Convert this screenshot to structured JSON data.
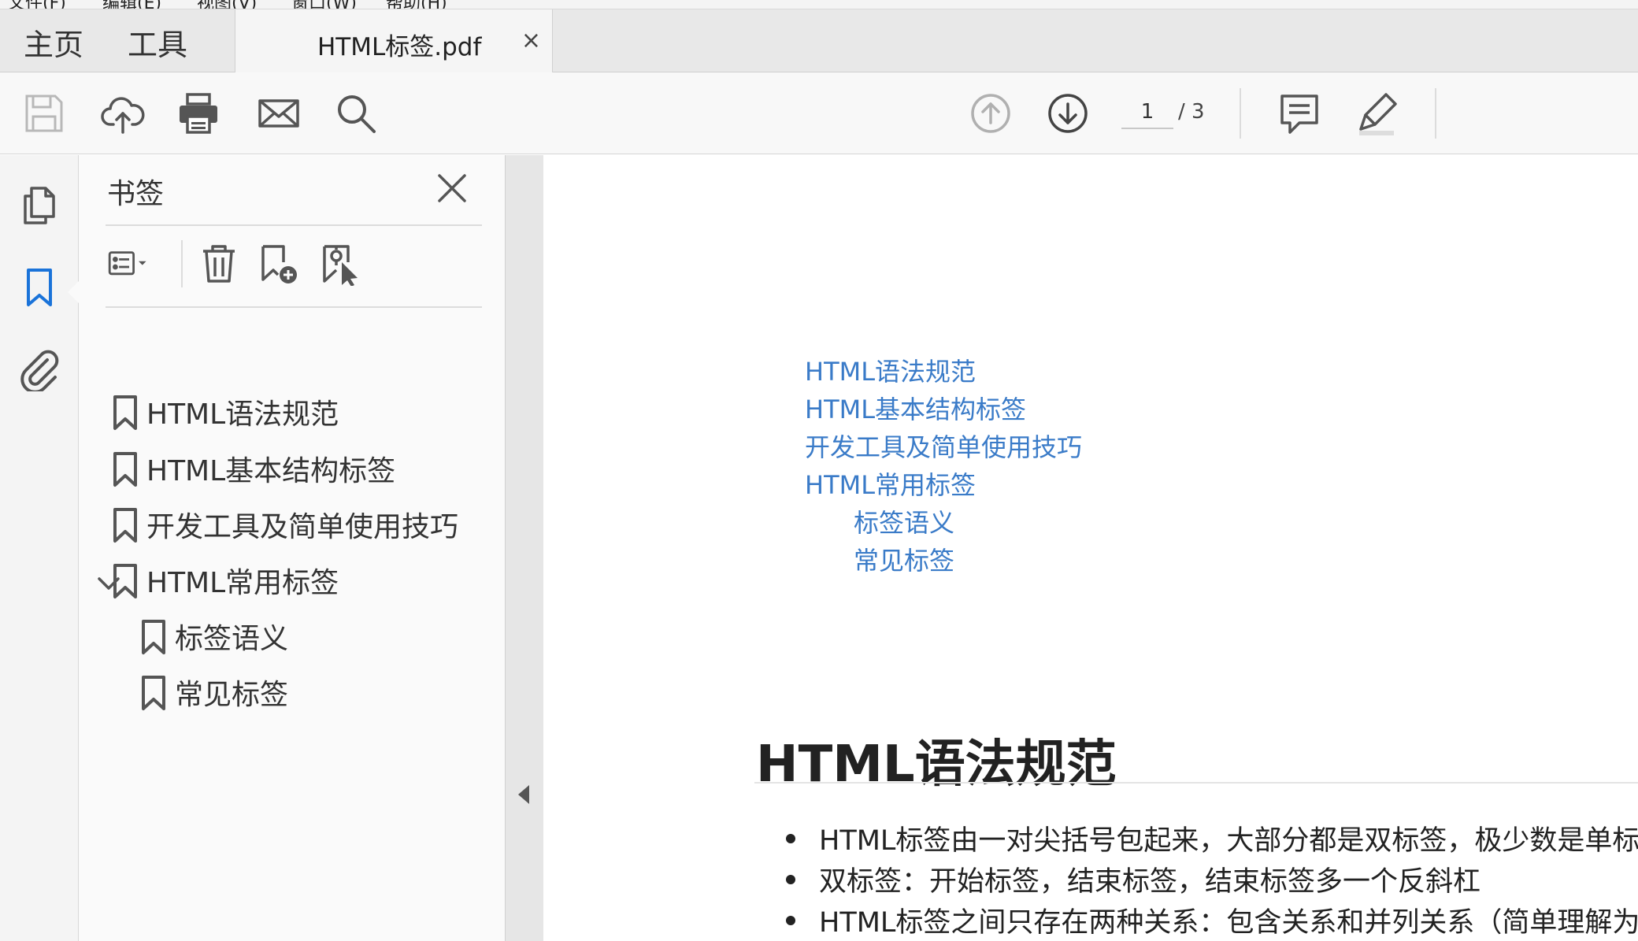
{
  "menubar": [
    "文件(F)",
    "编辑(E)",
    "视图(V)",
    "窗口(W)",
    "帮助(H)"
  ],
  "tabs": {
    "home": "主页",
    "tools": "工具",
    "document": "HTML标签.pdf",
    "close_glyph": "×"
  },
  "toolbar": {
    "icons": [
      "save-icon",
      "upload-icon",
      "print-icon",
      "email-icon",
      "search-icon",
      "page-up-icon",
      "page-down-icon",
      "comment-icon",
      "highlight-icon"
    ],
    "current_page": "1",
    "total_pages": "/ 3"
  },
  "rail": {
    "icons": [
      "pages-icon",
      "bookmark-icon",
      "attachment-icon"
    ],
    "active": "bookmark-icon"
  },
  "bookmarks_panel": {
    "title": "书签",
    "items": [
      {
        "label": "HTML语法规范",
        "level": 0
      },
      {
        "label": "HTML基本结构标签",
        "level": 0
      },
      {
        "label": "开发工具及简单使用技巧",
        "level": 0
      },
      {
        "label": "HTML常用标签",
        "level": 0,
        "expanded": true
      },
      {
        "label": "标签语义",
        "level": 1
      },
      {
        "label": "常见标签",
        "level": 1
      }
    ]
  },
  "document": {
    "toc": [
      "HTML语法规范",
      "HTML基本结构标签",
      "开发工具及简单使用技巧",
      "HTML常用标签",
      "标签语义",
      "常见标签"
    ],
    "heading": "HTML语法规范",
    "bullets": [
      "HTML标签由一对尖括号包起来，大部分都是双标签，极少数是单标签",
      "双标签：开始标签，结束标签，结束标签多一个反斜杠",
      "HTML标签之间只存在两种关系：包含关系和并列关系（简单理解为父子和兄弟）"
    ]
  },
  "colors": {
    "accent": "#1a73d9",
    "link": "#3a7bc8"
  }
}
